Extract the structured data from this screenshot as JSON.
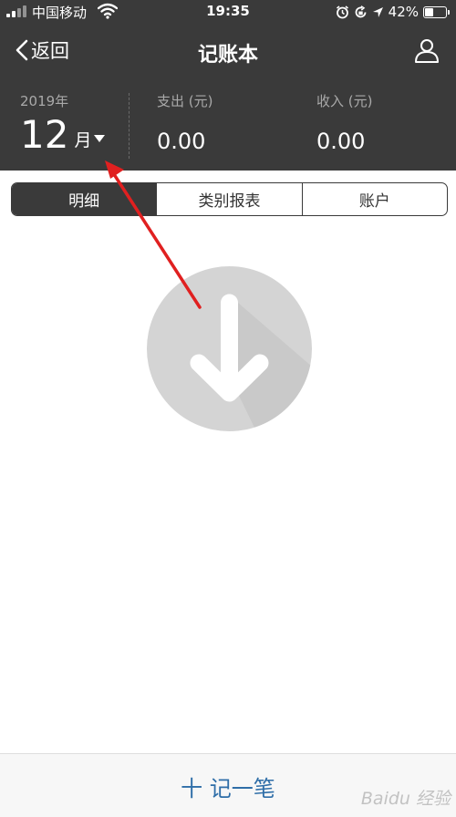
{
  "status_bar": {
    "carrier": "中国移动",
    "time": "19:35",
    "battery": "42%",
    "battery_level": 0.42,
    "icons": [
      "signal-icon",
      "wifi-icon",
      "alarm-icon",
      "rotation-lock-icon",
      "location-icon",
      "battery-icon"
    ]
  },
  "nav": {
    "back_label": "返回",
    "title": "记账本",
    "user_icon": "user-icon"
  },
  "summary": {
    "year": "2019年",
    "month": "12",
    "month_unit": "月",
    "expense_label": "支出 (元)",
    "expense_value": "0.00",
    "income_label": "收入 (元)",
    "income_value": "0.00"
  },
  "tabs": [
    {
      "label": "明细",
      "active": true
    },
    {
      "label": "类别报表",
      "active": false
    },
    {
      "label": "账户",
      "active": false
    }
  ],
  "empty_state": {
    "icon": "download-arrow-icon"
  },
  "bottom": {
    "add_label": "十 记一笔"
  },
  "watermark": {
    "text": "Baidu 经验"
  },
  "colors": {
    "header_bg": "#3a3a3a",
    "accent_blue": "#2f6ea8",
    "annotation_red": "#e02020",
    "empty_icon_gray": "#d4d4d4"
  }
}
